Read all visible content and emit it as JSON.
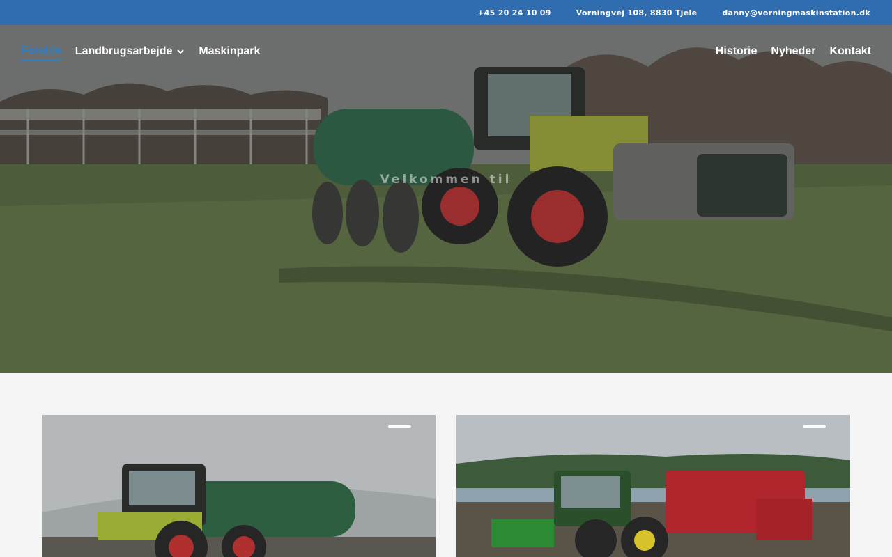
{
  "topbar": {
    "phone": "+45 20 24 10 09",
    "address": "Vorningvej 108, 8830 Tjele",
    "email": "danny@vorningmaskinstation.dk"
  },
  "nav": {
    "left": [
      {
        "label": "Forside",
        "active": true
      },
      {
        "label": "Landbrugsarbejde",
        "has_dropdown": true
      },
      {
        "label": "Maskinpark"
      }
    ],
    "right": [
      {
        "label": "Historie"
      },
      {
        "label": "Nyheder"
      },
      {
        "label": "Kontakt"
      }
    ]
  },
  "hero": {
    "welcome_text": "Velkommen til"
  },
  "colors": {
    "topbar_bg": "#2f6db0",
    "active_link": "#2f7ec9",
    "page_bg": "#f5f5f5"
  },
  "icons": {
    "dropdown": "chevron-down-icon"
  }
}
